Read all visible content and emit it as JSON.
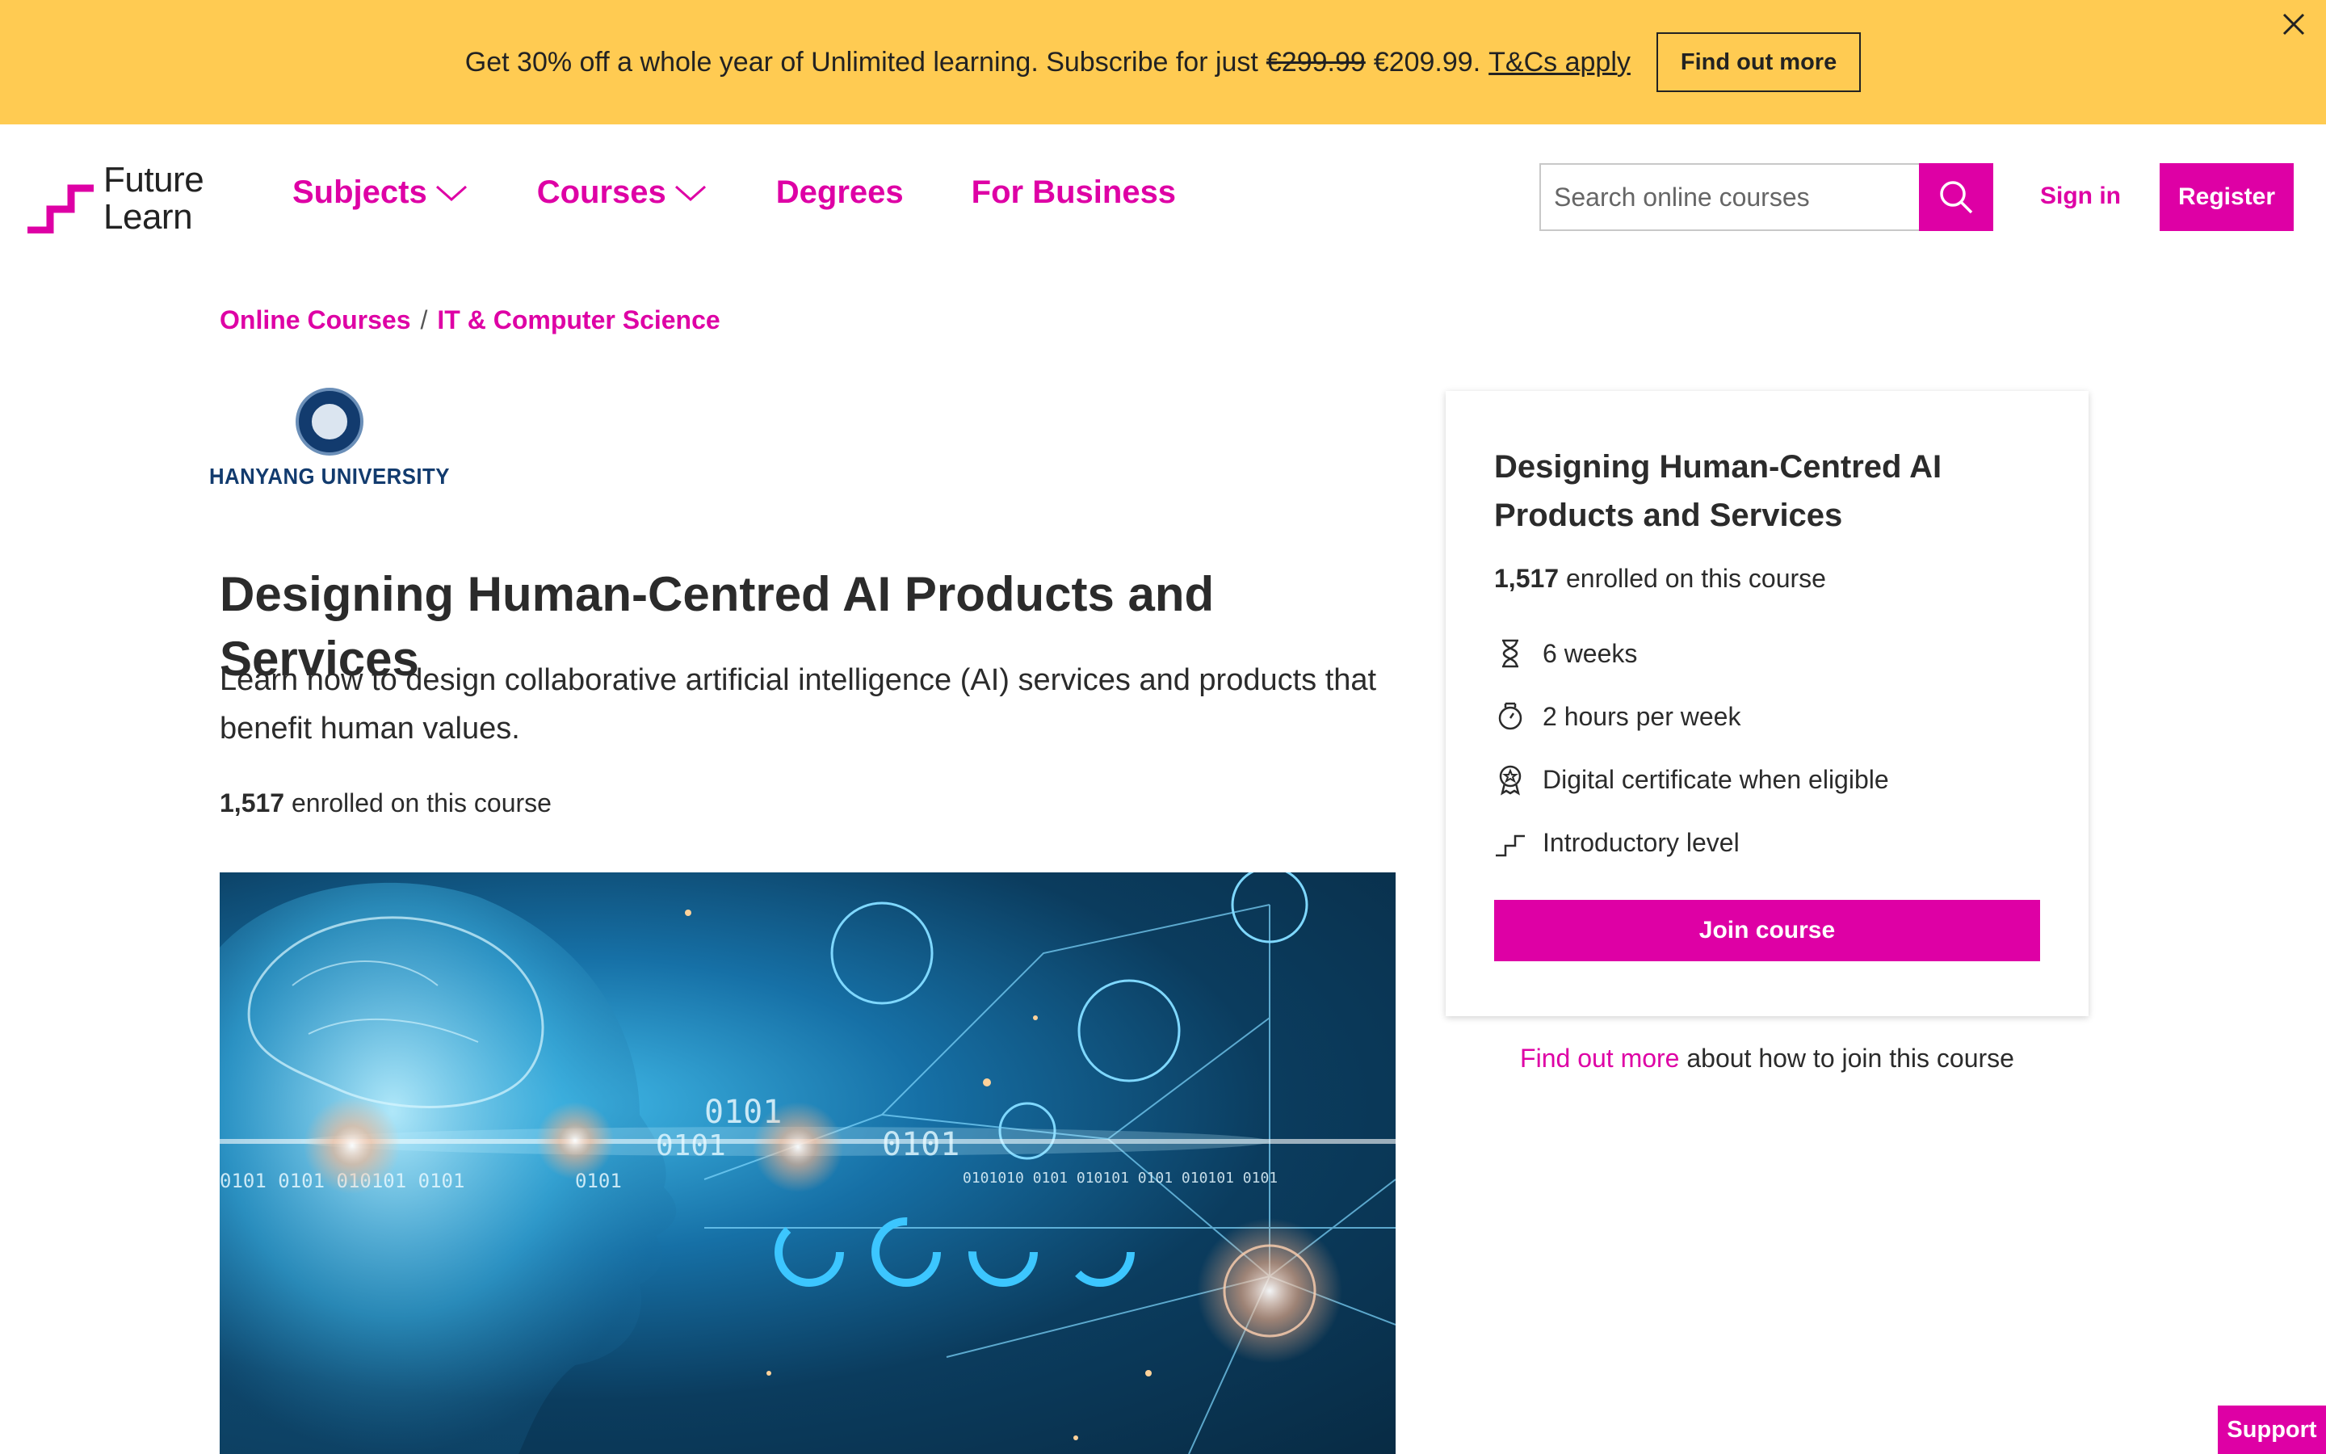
{
  "promo": {
    "text_before": "Get 30% off a whole year of Unlimited learning. Subscribe for just",
    "old_price": "€299.99",
    "new_price": "€209.99.",
    "terms_link": "T&Cs apply",
    "button_label": "Find out more",
    "close_icon": "close-icon"
  },
  "header": {
    "logo_line1": "Future",
    "logo_line2": "Learn",
    "nav": [
      {
        "label": "Subjects",
        "has_dropdown": true
      },
      {
        "label": "Courses",
        "has_dropdown": true
      },
      {
        "label": "Degrees",
        "has_dropdown": false
      },
      {
        "label": "For Business",
        "has_dropdown": false
      }
    ],
    "search_placeholder": "Search online courses",
    "signin_label": "Sign in",
    "register_label": "Register"
  },
  "breadcrumb": {
    "items": [
      "Online Courses",
      "IT & Computer Science"
    ],
    "separator": "/"
  },
  "university": {
    "name": "HANYANG UNIVERSITY"
  },
  "course": {
    "title": "Designing Human-Centred AI Products and Services",
    "description": "Learn how to design collaborative artificial intelligence (AI) services and products that benefit human values.",
    "enrolled_count": "1,517",
    "enrolled_text": "enrolled on this course"
  },
  "card": {
    "title": "Designing Human-Centred AI Products and Services",
    "enrolled_count": "1,517",
    "enrolled_text": "enrolled on this course",
    "features": [
      {
        "icon": "hourglass-icon",
        "label": "6 weeks"
      },
      {
        "icon": "stopwatch-icon",
        "label": "2 hours per week"
      },
      {
        "icon": "certificate-icon",
        "label": "Digital certificate when eligible"
      },
      {
        "icon": "steps-icon",
        "label": "Introductory level"
      }
    ],
    "join_label": "Join course"
  },
  "find_out": {
    "link": "Find out more",
    "text": "about how to join this course"
  },
  "support_label": "Support",
  "colors": {
    "brand": "#de00a5",
    "promo_bg": "#ffcb52",
    "university_blue": "#123b6e"
  }
}
